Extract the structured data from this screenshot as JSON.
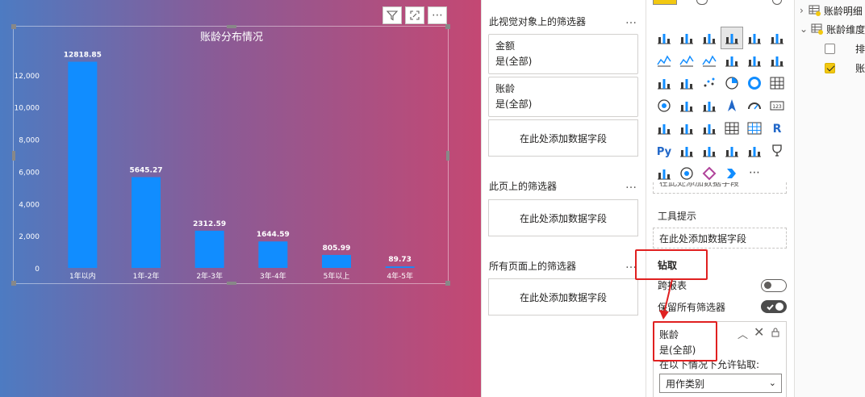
{
  "visual_toolbar": {
    "filter_icon": "filter-icon",
    "focus_icon": "focus-mode-icon",
    "more": "⋯"
  },
  "chart_data": {
    "type": "bar",
    "title": "账龄分布情况",
    "categories": [
      "1年以内",
      "1年-2年",
      "2年-3年",
      "3年-4年",
      "5年以上",
      "4年-5年"
    ],
    "values": [
      12818.85,
      5645.27,
      2312.59,
      1644.59,
      805.99,
      89.73
    ],
    "data_labels": [
      "12818.85",
      "5645.27",
      "2312.59",
      "1644.59",
      "805.99",
      "89.73"
    ],
    "yticks": [
      "12,000",
      "10,000",
      "8,000",
      "6,000",
      "4,000",
      "2,000",
      "0"
    ],
    "ylim": [
      0,
      14000
    ],
    "bar_color": "#118dff",
    "grid": false,
    "xlabel": "",
    "ylabel": ""
  },
  "filters": {
    "visual_title": "此视觉对象上的筛选器",
    "visual_cards": [
      {
        "name": "金额",
        "value": "是(全部)"
      },
      {
        "name": "账龄",
        "value": "是(全部)"
      }
    ],
    "add_field": "在此处添加数据字段",
    "page_title": "此页上的筛选器",
    "all_pages_title": "所有页面上的筛选器",
    "more": "…"
  },
  "viz": {
    "tooltip_label": "工具提示",
    "tooltip_well": "在此处添加数据字段",
    "drillthrough_label": "钻取",
    "cross_report_label": "跨报表",
    "keep_filters_label": "保留所有筛选器",
    "drill_card": {
      "name": "账龄",
      "value": "是(全部)"
    },
    "allow_label": "在以下情况下允许钻取:",
    "allow_select": "用作类别",
    "cut_text": "在此处添加数据字段",
    "colors": {
      "accent": "#118dff",
      "highlight": "#e02020"
    }
  },
  "fields": {
    "items": [
      {
        "label": "账龄明细"
      },
      {
        "label": "账龄维度"
      },
      {
        "label": "排"
      },
      {
        "label": "账"
      }
    ]
  }
}
